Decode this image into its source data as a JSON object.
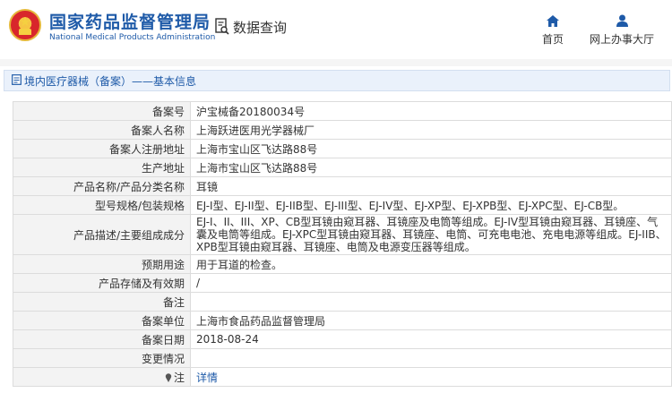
{
  "header": {
    "org_name_cn": "国家药品监督管理局",
    "org_name_en": "National Medical Products Administration",
    "query_label": "数据查询",
    "nav": [
      {
        "label": "首页",
        "icon": "home-icon"
      },
      {
        "label": "网上办事大厅",
        "icon": "user-icon"
      }
    ]
  },
  "section": {
    "title": "境内医疗器械（备案）——基本信息"
  },
  "record": {
    "rows": [
      {
        "label": "备案号",
        "value": "沪宝械备20180034号"
      },
      {
        "label": "备案人名称",
        "value": "上海跃进医用光学器械厂"
      },
      {
        "label": "备案人注册地址",
        "value": "上海市宝山区飞达路88号"
      },
      {
        "label": "生产地址",
        "value": "上海市宝山区飞达路88号"
      },
      {
        "label": "产品名称/产品分类名称",
        "value": "耳镜"
      },
      {
        "label": "型号规格/包装规格",
        "value": "EJ-I型、EJ-II型、EJ-IIB型、EJ-III型、EJ-IV型、EJ-XP型、EJ-XPB型、EJ-XPC型、EJ-CB型。"
      },
      {
        "label": "产品描述/主要组成成分",
        "value": "EJ-I、II、III、XP、CB型耳镜由窥耳器、耳镜座及电筒等组成。EJ-IV型耳镜由窥耳器、耳镜座、气囊及电筒等组成。EJ-XPC型耳镜由窥耳器、耳镜座、电筒、可充电电池、充电电源等组成。EJ-IIB、XPB型耳镜由窥耳器、耳镜座、电筒及电源变压器等组成。"
      },
      {
        "label": "预期用途",
        "value": "用于耳道的检查。"
      },
      {
        "label": "产品存储及有效期",
        "value": "/"
      },
      {
        "label": "备注",
        "value": ""
      },
      {
        "label": "备案单位",
        "value": "上海市食品药品监督管理局"
      },
      {
        "label": "备案日期",
        "value": "2018-08-24"
      },
      {
        "label": "变更情况",
        "value": ""
      },
      {
        "label": "注",
        "value": "详情"
      }
    ]
  },
  "colors": {
    "brand_blue": "#1e5aa8",
    "label_bg": "#f3f3f3",
    "section_bg": "#eaf1fb"
  }
}
